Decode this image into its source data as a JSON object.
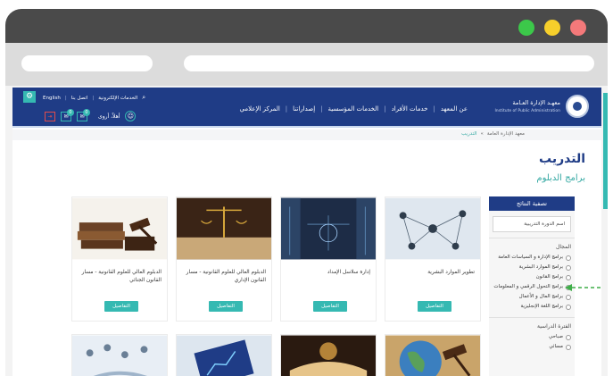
{
  "header": {
    "logo_title": "معهـد الإدارة العـامة",
    "logo_subtitle": "Institute of Public Administration",
    "nav": [
      "عن المعهد",
      "خدمات الأفراد",
      "الخدمات المؤسسية",
      "إصداراتنا",
      "المركز الإعلامي"
    ],
    "util": [
      "الخدمات الإلكترونية",
      "اتصل بنا",
      "English"
    ],
    "user_label": "أهلاً، أروى",
    "badge_1": "0",
    "badge_2": "0"
  },
  "breadcrumb": [
    "معهد الإدارة العامة",
    "التدريب"
  ],
  "page_title": "التدريب",
  "section_title": "برامج الدبلوم",
  "filter": {
    "title": "تصفية النتائج",
    "search_placeholder": "اسم الدورة التدريبية",
    "group1_label": "المجال",
    "group1_options": [
      "برامج الإدارة و السياسات العامة",
      "برامج الموارد البشرية",
      "برامج القانون",
      "برامج التحول الرقمي و المعلومات",
      "برامج المال و الأعمال",
      "برامج اللغة الإنجليزية"
    ],
    "group2_label": "الفترة الدراسية",
    "group2_options": [
      "صباحي",
      "مسائي"
    ]
  },
  "cards": [
    {
      "title": "تطوير الموارد البشرية",
      "button": "التفاصيل"
    },
    {
      "title": "إدارة سلاسل الإمداد",
      "button": "التفاصيل"
    },
    {
      "title": "الدبلوم العالي للعلوم القانونية - مسار القانون الإداري",
      "button": "التفاصيل"
    },
    {
      "title": "الدبلوم العالي للعلوم القانونية - مسار القانون الجنائي",
      "button": "التفاصيل"
    }
  ],
  "colors": {
    "navy": "#1f3c86",
    "teal": "#35b9b2",
    "accent_green": "#35a9a3"
  }
}
